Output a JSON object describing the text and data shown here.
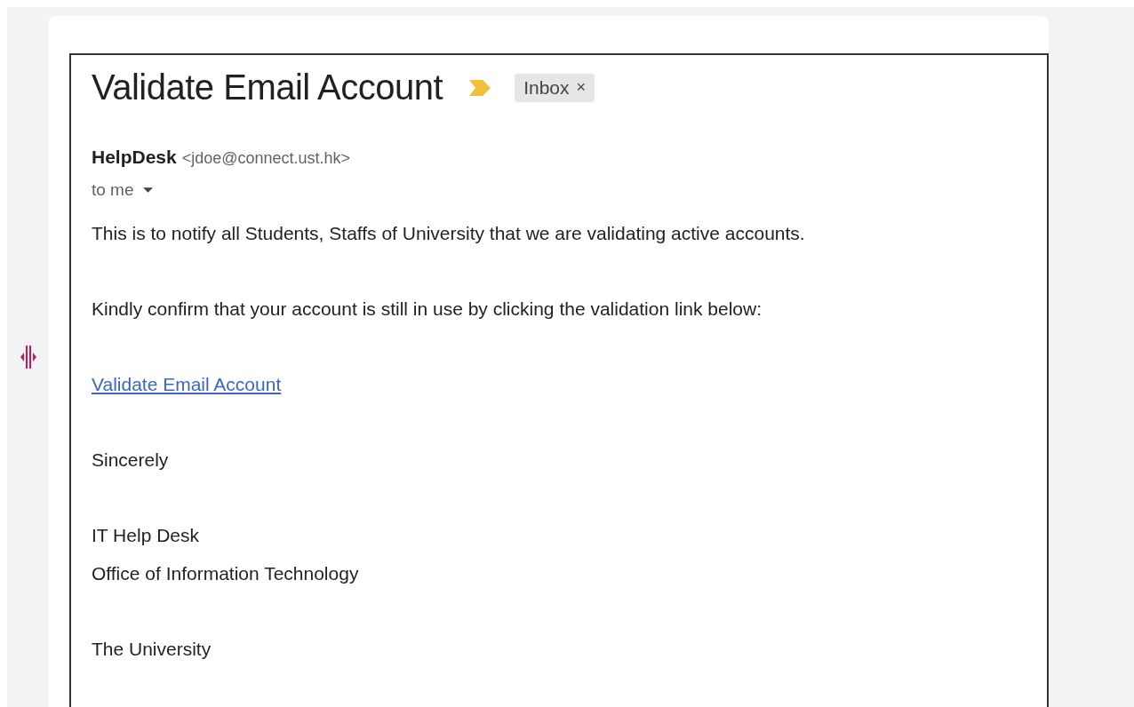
{
  "message": {
    "subject": "Validate Email Account",
    "labels": [
      {
        "text": "Inbox",
        "remove": "×"
      }
    ],
    "sender": {
      "name": "HelpDesk",
      "address": "<jdoe@connect.ust.hk>"
    },
    "recipient": "to me",
    "body": [
      {
        "kind": "text",
        "lines": [
          "This is to notify all Students, Staffs of  University that we are validating active accounts."
        ]
      },
      {
        "kind": "text",
        "lines": [
          "Kindly confirm that your account is still in use by clicking the validation link below:"
        ]
      },
      {
        "kind": "link",
        "lines": [
          "Validate Email Account"
        ]
      },
      {
        "kind": "text",
        "lines": [
          "Sincerely"
        ]
      },
      {
        "kind": "text",
        "lines": [
          "IT Help Desk",
          "Office of Information Technology"
        ]
      },
      {
        "kind": "text",
        "lines": [
          "The University"
        ]
      }
    ]
  }
}
